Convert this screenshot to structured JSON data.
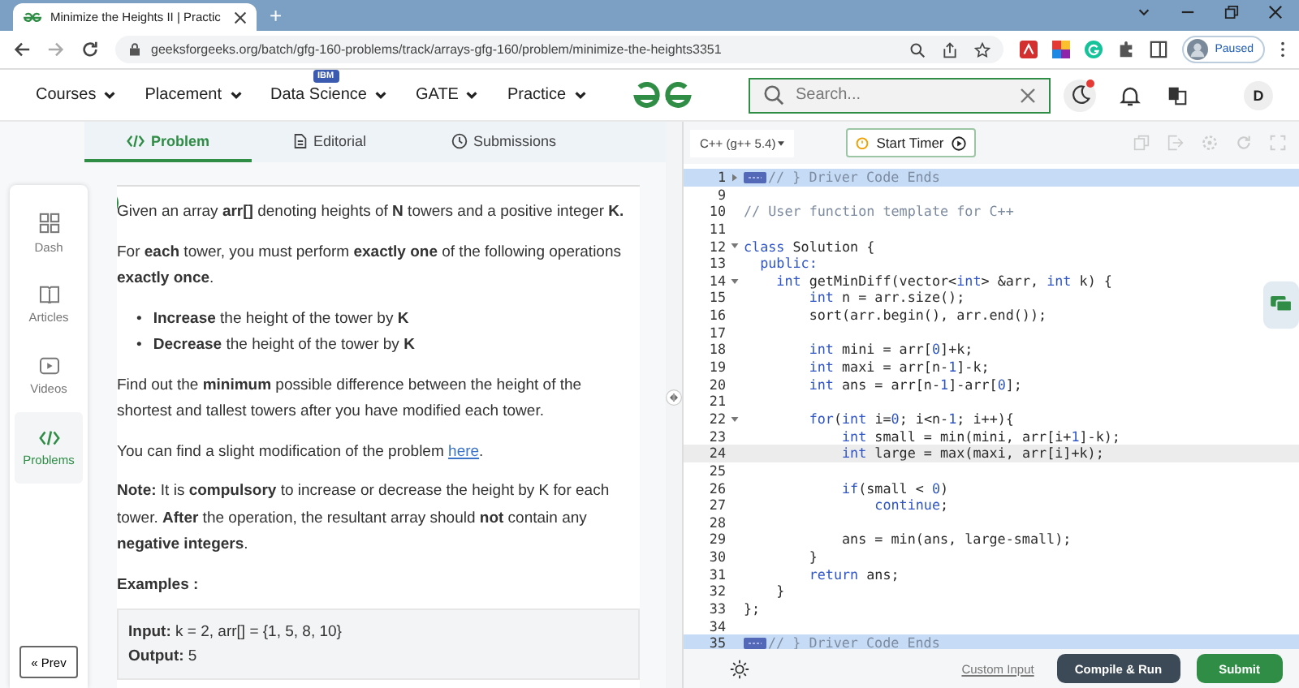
{
  "browser": {
    "tab_title": "Minimize the Heights II | Practic",
    "new_tab": "+",
    "url": "geeksforgeeks.org/batch/gfg-160-problems/track/arrays-gfg-160/problem/minimize-the-heights3351",
    "profile": "Paused"
  },
  "nav": {
    "items": [
      {
        "label": "Courses"
      },
      {
        "label": "Placement"
      },
      {
        "label": "Data Science",
        "badge": "IBM"
      },
      {
        "label": "GATE"
      },
      {
        "label": "Practice"
      }
    ],
    "search": {
      "placeholder": "Search..."
    },
    "notification": true,
    "avatar": "D"
  },
  "problem_tabs": [
    {
      "label": "Problem",
      "selected": true
    },
    {
      "label": "Editorial",
      "selected": false
    },
    {
      "label": "Submissions",
      "selected": false
    }
  ],
  "sidebar": {
    "items": [
      {
        "label": "Dash",
        "kind": "dash",
        "selected": false
      },
      {
        "label": "Articles",
        "kind": "articles",
        "selected": false
      },
      {
        "label": "Videos",
        "kind": "videos",
        "selected": false
      },
      {
        "label": "Problems",
        "kind": "problems",
        "selected": true
      }
    ],
    "prev": "« Prev"
  },
  "statement": {
    "paragraphs": [
      {
        "kind": "text",
        "text": "Given an array **arr[]** denoting heights of **N** towers and a positive integer **K.**"
      },
      {
        "kind": "text",
        "text": "For **each** tower, you must perform **exactly one** of the following operations **exactly once**."
      },
      {
        "kind": "list",
        "items": [
          {
            "bullet": "•",
            "text": "**Increase** the height of the tower by **K**"
          },
          {
            "bullet": "•",
            "text": "**Decrease** the height of the tower by **K**"
          }
        ]
      },
      {
        "kind": "text",
        "text": "Find out the **minimum** possible difference between the height of the shortest and tallest towers after you have modified each tower."
      },
      {
        "kind": "link",
        "text": "You can find a slight modification of the problem ",
        "link": "here",
        "after": "."
      },
      {
        "kind": "note",
        "text": "**Note:** It is **compulsory** to increase or decrease the height by K for each tower. **After** the operation, the resultant array should **not** contain any **negative integers**."
      }
    ],
    "examples_heading": "Examples :",
    "example": [
      "**Input:** k = 2, arr[] = {1, 5, 8, 10}",
      "**Output:** 5"
    ]
  },
  "editor": {
    "language": "C++ (g++ 5.4)",
    "timer": "Start Timer",
    "lines": [
      {
        "n": "1",
        "expanded": false,
        "folded": true,
        "selected": true,
        "current": false,
        "tokens": [
          {
            "kind": "comment",
            "text": "// } Driver Code Ends"
          }
        ]
      },
      {
        "n": "9",
        "selected": false,
        "current": false
      },
      {
        "n": "10",
        "selected": false,
        "current": false,
        "tokens": [
          {
            "kind": "comment",
            "text": "// User function template for C++"
          }
        ]
      },
      {
        "n": "11",
        "selected": false,
        "current": false
      },
      {
        "n": "12",
        "expanded": true,
        "selected": false,
        "current": false,
        "tokens": [
          {
            "kind": "kw",
            "text": "class"
          },
          {
            "kind": "plain",
            "text": " Solution {"
          }
        ]
      },
      {
        "n": "13",
        "selected": false,
        "current": false,
        "tokens": [
          {
            "kind": "kw",
            "text": "  public:"
          }
        ]
      },
      {
        "n": "14",
        "expanded": true,
        "selected": false,
        "current": false,
        "tokens": [
          {
            "kind": "kw",
            "text": "    int"
          },
          {
            "kind": "plain",
            "text": " getMinDiff(vector<"
          },
          {
            "kind": "kw",
            "text": "int"
          },
          {
            "kind": "plain",
            "text": "> &arr, "
          },
          {
            "kind": "kw",
            "text": "int"
          },
          {
            "kind": "plain",
            "text": " k) {"
          }
        ]
      },
      {
        "n": "15",
        "selected": false,
        "current": false,
        "tokens": [
          {
            "kind": "kw",
            "text": "        int"
          },
          {
            "kind": "plain",
            "text": " n = arr.size();"
          }
        ]
      },
      {
        "n": "16",
        "selected": false,
        "current": false,
        "tokens": [
          {
            "kind": "plain",
            "text": "        sort(arr.begin(), arr.end());"
          }
        ]
      },
      {
        "n": "17",
        "selected": false,
        "current": false
      },
      {
        "n": "18",
        "selected": false,
        "current": false,
        "tokens": [
          {
            "kind": "kw",
            "text": "        int"
          },
          {
            "kind": "plain",
            "text": " mini = arr["
          },
          {
            "kind": "num",
            "text": "0"
          },
          {
            "kind": "plain",
            "text": "]+k;"
          }
        ]
      },
      {
        "n": "19",
        "selected": false,
        "current": false,
        "tokens": [
          {
            "kind": "kw",
            "text": "        int"
          },
          {
            "kind": "plain",
            "text": " maxi = arr[n-"
          },
          {
            "kind": "num",
            "text": "1"
          },
          {
            "kind": "plain",
            "text": "]-k;"
          }
        ]
      },
      {
        "n": "20",
        "selected": false,
        "current": false,
        "tokens": [
          {
            "kind": "kw",
            "text": "        int"
          },
          {
            "kind": "plain",
            "text": " ans = arr[n-"
          },
          {
            "kind": "num",
            "text": "1"
          },
          {
            "kind": "plain",
            "text": "]-arr["
          },
          {
            "kind": "num",
            "text": "0"
          },
          {
            "kind": "plain",
            "text": "];"
          }
        ]
      },
      {
        "n": "21",
        "selected": false,
        "current": false
      },
      {
        "n": "22",
        "expanded": true,
        "selected": false,
        "current": false,
        "tokens": [
          {
            "kind": "kw",
            "text": "        for"
          },
          {
            "kind": "plain",
            "text": "("
          },
          {
            "kind": "kw",
            "text": "int"
          },
          {
            "kind": "plain",
            "text": " i="
          },
          {
            "kind": "num",
            "text": "0"
          },
          {
            "kind": "plain",
            "text": "; i<n-"
          },
          {
            "kind": "num",
            "text": "1"
          },
          {
            "kind": "plain",
            "text": "; i++){"
          }
        ]
      },
      {
        "n": "23",
        "selected": false,
        "current": false,
        "tokens": [
          {
            "kind": "kw",
            "text": "            int"
          },
          {
            "kind": "plain",
            "text": " small = min(mini, arr[i+"
          },
          {
            "kind": "num",
            "text": "1"
          },
          {
            "kind": "plain",
            "text": "]-k);"
          }
        ]
      },
      {
        "n": "24",
        "selected": false,
        "current": true,
        "tokens": [
          {
            "kind": "kw",
            "text": "            int"
          },
          {
            "kind": "plain",
            "text": " large = max(maxi, arr[i]+k);"
          }
        ]
      },
      {
        "n": "25",
        "selected": false,
        "current": false
      },
      {
        "n": "26",
        "selected": false,
        "current": false,
        "tokens": [
          {
            "kind": "kw",
            "text": "            if"
          },
          {
            "kind": "plain",
            "text": "(small < "
          },
          {
            "kind": "num",
            "text": "0"
          },
          {
            "kind": "plain",
            "text": ")"
          }
        ]
      },
      {
        "n": "27",
        "selected": false,
        "current": false,
        "tokens": [
          {
            "kind": "kw",
            "text": "                continue"
          },
          {
            "kind": "plain",
            "text": ";"
          }
        ]
      },
      {
        "n": "28",
        "selected": false,
        "current": false
      },
      {
        "n": "29",
        "selected": false,
        "current": false,
        "tokens": [
          {
            "kind": "plain",
            "text": "            ans = min(ans, large-small);"
          }
        ]
      },
      {
        "n": "30",
        "selected": false,
        "current": false,
        "tokens": [
          {
            "kind": "plain",
            "text": "        }"
          }
        ]
      },
      {
        "n": "31",
        "selected": false,
        "current": false,
        "tokens": [
          {
            "kind": "kw",
            "text": "        return"
          },
          {
            "kind": "plain",
            "text": " ans;"
          }
        ]
      },
      {
        "n": "32",
        "selected": false,
        "current": false,
        "tokens": [
          {
            "kind": "plain",
            "text": "    }"
          }
        ]
      },
      {
        "n": "33",
        "selected": false,
        "current": false,
        "tokens": [
          {
            "kind": "plain",
            "text": "};"
          }
        ]
      },
      {
        "n": "34",
        "selected": false,
        "current": false
      },
      {
        "n": "35",
        "folded": true,
        "selected": true,
        "current": false,
        "tokens": [
          {
            "kind": "comment",
            "text": "// } Driver Code Ends"
          }
        ]
      }
    ],
    "custom_input": "Custom Input",
    "compile": "Compile & Run",
    "submit": "Submit"
  }
}
